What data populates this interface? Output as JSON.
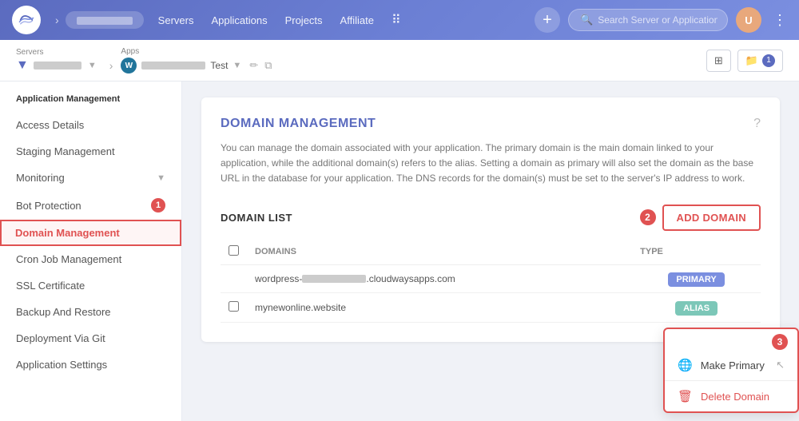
{
  "topnav": {
    "links": [
      "Servers",
      "Applications",
      "Projects",
      "Affiliate"
    ],
    "search_placeholder": "Search Server or Application",
    "plus_label": "+",
    "avatar_initials": "U"
  },
  "subnav": {
    "servers_label": "Servers",
    "apps_label": "Apps",
    "server_name": "██████",
    "app_name": "████████████",
    "app_test_label": "Test",
    "folder_count": "1"
  },
  "sidebar": {
    "section_title": "Application Management",
    "items": [
      {
        "label": "Access Details",
        "active": false,
        "badge": null,
        "chevron": false
      },
      {
        "label": "Staging Management",
        "active": false,
        "badge": null,
        "chevron": false
      },
      {
        "label": "Monitoring",
        "active": false,
        "badge": null,
        "chevron": true
      },
      {
        "label": "Bot Protection",
        "active": false,
        "badge": "1",
        "chevron": false
      },
      {
        "label": "Domain Management",
        "active": true,
        "badge": null,
        "chevron": false
      },
      {
        "label": "Cron Job Management",
        "active": false,
        "badge": null,
        "chevron": false
      },
      {
        "label": "SSL Certificate",
        "active": false,
        "badge": null,
        "chevron": false
      },
      {
        "label": "Backup And Restore",
        "active": false,
        "badge": null,
        "chevron": false
      },
      {
        "label": "Deployment Via Git",
        "active": false,
        "badge": null,
        "chevron": false
      },
      {
        "label": "Application Settings",
        "active": false,
        "badge": null,
        "chevron": false
      }
    ]
  },
  "main": {
    "section_title": "DOMAIN MANAGEMENT",
    "description": "You can manage the domain associated with your application. The primary domain is the main domain linked to your application, while the additional domain(s) refers to the alias. Setting a domain as primary will also set the domain as the base URL in the database for your application. The DNS records for the domain(s) must be set to the server's IP address to work.",
    "domain_list_title": "DOMAIN LIST",
    "add_domain_btn": "ADD DOMAIN",
    "step2_label": "2",
    "table": {
      "col_domains": "DOMAINS",
      "col_type": "TYPE",
      "rows": [
        {
          "domain": "wordpress-████████████.cloudwaysapps.com",
          "type": "PRIMARY",
          "type_class": "primary"
        },
        {
          "domain": "mynewonline.website",
          "type": "ALIAS",
          "type_class": "alias"
        }
      ]
    },
    "context_menu": {
      "step3_label": "3",
      "items": [
        {
          "label": "Make Primary",
          "icon": "globe"
        },
        {
          "label": "Delete Domain",
          "icon": "trash",
          "type": "delete"
        }
      ]
    }
  }
}
